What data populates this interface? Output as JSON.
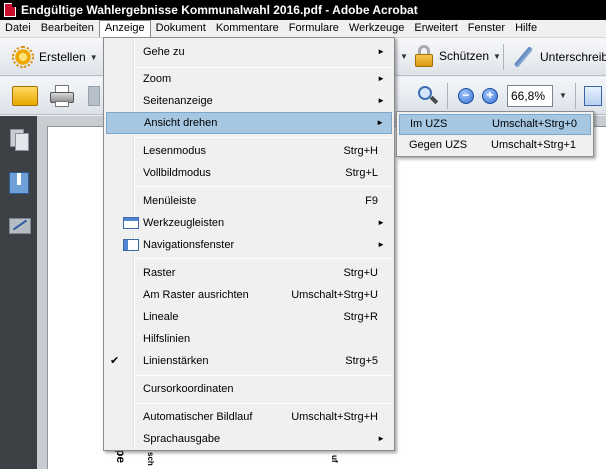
{
  "window": {
    "title": "Endgültige Wahlergebnisse Kommunalwahl 2016.pdf - Adobe Acrobat"
  },
  "menubar": {
    "items": [
      "Datei",
      "Bearbeiten",
      "Anzeige",
      "Dokument",
      "Kommentare",
      "Formulare",
      "Werkzeuge",
      "Erweitert",
      "Fenster",
      "Hilfe"
    ],
    "active": "Anzeige"
  },
  "toolbar1": {
    "create_label": "Erstellen",
    "protect_label": "Schützen",
    "sign_label": "Unterschreib"
  },
  "toolbar2": {
    "zoom_value": "66,8%",
    "zoom_out": "−",
    "zoom_in": "+"
  },
  "icons": {
    "app": "pdf-app-icon",
    "create": "gear-icon",
    "protect": "lock-icon",
    "sign": "pen-icon",
    "open": "folder-icon",
    "print": "printer-icon",
    "save": "disk-icon",
    "find": "magnifier-icon",
    "zoom_out": "zoom-out-icon",
    "zoom_in": "zoom-in-icon",
    "fit": "fit-page-icon",
    "nav_pages": "pages-icon",
    "nav_bookmarks": "bookmark-icon",
    "nav_signatures": "signature-icon",
    "submenu_arrow": "►",
    "check": "✔"
  },
  "menu": {
    "items": [
      {
        "label": "Gehe zu",
        "shortcut": "",
        "arrow": true
      },
      {
        "label": "Zoom",
        "shortcut": "",
        "arrow": true
      },
      {
        "label": "Seitenanzeige",
        "shortcut": "",
        "arrow": true
      },
      {
        "label": "Ansicht drehen",
        "shortcut": "",
        "arrow": true,
        "highlighted": true
      },
      {
        "label": "Lesenmodus",
        "shortcut": "Strg+H"
      },
      {
        "label": "Vollbildmodus",
        "shortcut": "Strg+L"
      },
      {
        "label": "Menüleiste",
        "shortcut": "F9"
      },
      {
        "label": "Werkzeugleisten",
        "shortcut": "",
        "arrow": true
      },
      {
        "label": "Navigationsfenster",
        "shortcut": "",
        "arrow": true
      },
      {
        "label": "Raster",
        "shortcut": "Strg+U"
      },
      {
        "label": "Am Raster ausrichten",
        "shortcut": "Umschalt+Strg+U"
      },
      {
        "label": "Lineale",
        "shortcut": "Strg+R"
      },
      {
        "label": "Hilfslinien",
        "shortcut": ""
      },
      {
        "label": "Linienstärken",
        "shortcut": "Strg+5",
        "checked": true
      },
      {
        "label": "Cursorkoordinaten",
        "shortcut": ""
      },
      {
        "label": "Automatischer Bildlauf",
        "shortcut": "Umschalt+Strg+H"
      },
      {
        "label": "Sprachausgabe",
        "shortcut": "",
        "arrow": true
      }
    ]
  },
  "submenu": {
    "items": [
      {
        "label": "Im UZS",
        "shortcut": "Umschalt+Strg+0",
        "highlighted": true
      },
      {
        "label": "Gegen UZS",
        "shortcut": "Umschalt+Strg+1"
      }
    ]
  },
  "document": {
    "rotated_text_1": "pe",
    "rotated_text_2": "sch",
    "rotated_text_3": "uf"
  },
  "colors": {
    "highlight": "#a6c7e2",
    "titlebar": "#000000",
    "navpane": "#3d4146"
  }
}
